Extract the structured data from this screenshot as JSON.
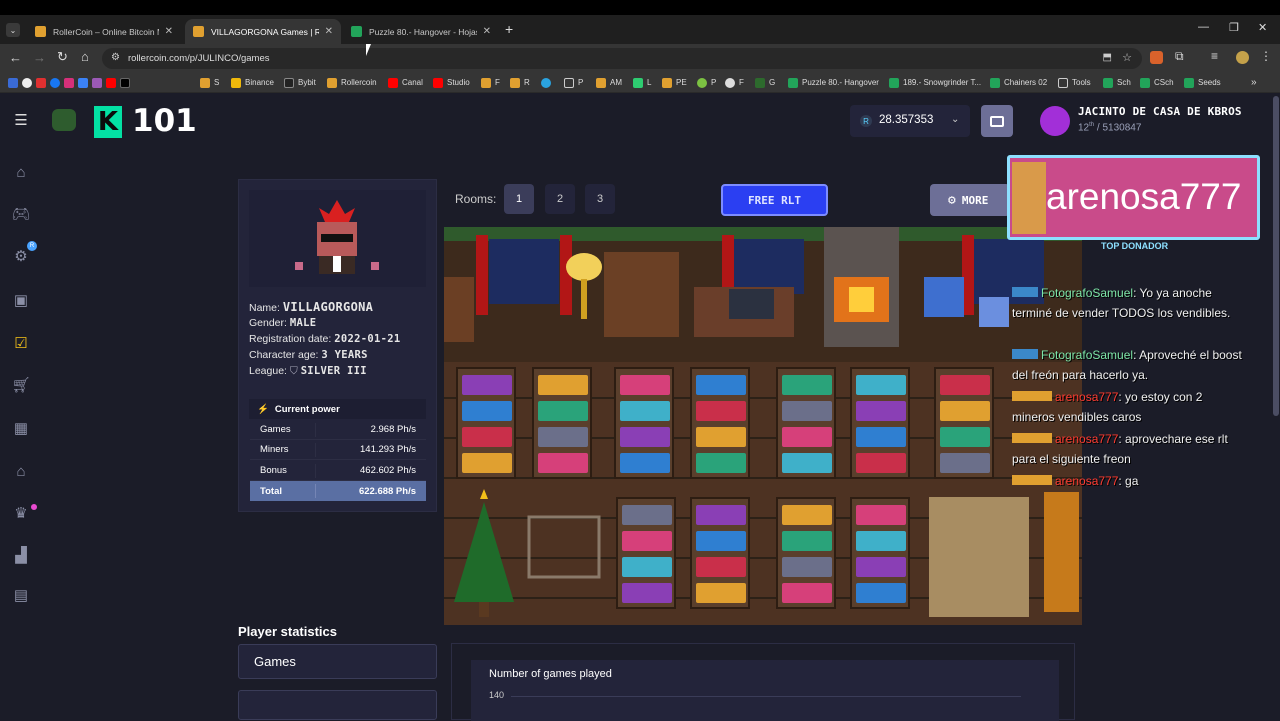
{
  "browser": {
    "tabs": [
      {
        "label": "RollerCoin – Online Bitcoin Mining",
        "active": false
      },
      {
        "label": "VILLAGORGONA Games | Roller",
        "active": true
      },
      {
        "label": "Puzzle 80.- Hangover - Hojas de",
        "active": false
      }
    ],
    "new_tab": "+",
    "url": "rollercoin.com/p/JULINCO/games",
    "bookmarks": [
      "S",
      "Binance",
      "Bybit",
      "Rollercoin",
      "Canal",
      "Studio",
      "F",
      "R",
      "P",
      "AM",
      "L",
      "PE",
      "P",
      "F",
      "G",
      "Puzzle 80.- Hangover",
      "189.- Snowgrinder T...",
      "Chainers 02",
      "Tools",
      "Sch",
      "CSch",
      "Seeds"
    ]
  },
  "header": {
    "level": "101",
    "level_badge": "K",
    "balance_currency": "R",
    "balance": "28.357353",
    "username": "JACINTO DE CASA DE KBROS",
    "rank": "12",
    "rank_suffix": "th",
    "rank_total": "/ 5130847"
  },
  "profile": {
    "name_label": "Name:",
    "name": "VILLAGORGONA",
    "gender_label": "Gender:",
    "gender": "MALE",
    "reg_label": "Registration date:",
    "reg_date": "2022-01-21",
    "age_label": "Character age:",
    "age": "3 YEARS",
    "league_label": "League:",
    "league": "SILVER III",
    "power_title": "Current power",
    "power": [
      {
        "label": "Games",
        "value": "2.968 Ph/s"
      },
      {
        "label": "Miners",
        "value": "141.293 Ph/s"
      },
      {
        "label": "Bonus",
        "value": "462.602 Ph/s"
      },
      {
        "label": "Total",
        "value": "622.688 Ph/s"
      }
    ]
  },
  "rooms": {
    "label": "Rooms:",
    "items": [
      "1",
      "2",
      "3"
    ],
    "free_rlt": "FREE RLT",
    "more": "MORE"
  },
  "stats": {
    "title": "Player statistics",
    "games_tab": "Games",
    "chart_title": "Number of games played",
    "chart_y_top": "140"
  },
  "overlay": {
    "donor_name": "arenosa777",
    "donor_caption": "TOP DONADOR",
    "chat": [
      {
        "user": "FotografoSamuel",
        "text": ": Yo ya anoche terminé de vender TODOS los vendibles.",
        "color": "green"
      },
      {
        "user": "FotografoSamuel",
        "text": ": Aproveché el boost del freón para hacerlo ya.",
        "color": "green"
      },
      {
        "user": "arenosa777",
        "text": ": yo estoy con 2 mineros vendibles caros",
        "color": "red"
      },
      {
        "user": "arenosa777",
        "text": ": aprovechare ese rlt para el siguiente freon",
        "color": "red"
      },
      {
        "user": "arenosa777",
        "text": ": ga",
        "color": "red"
      }
    ]
  },
  "colors": {
    "accent_green": "#03e1e4",
    "total_row": "#5a6fa3",
    "free_rlt": "#2b3ff2",
    "more_btn": "#6d6f97"
  }
}
